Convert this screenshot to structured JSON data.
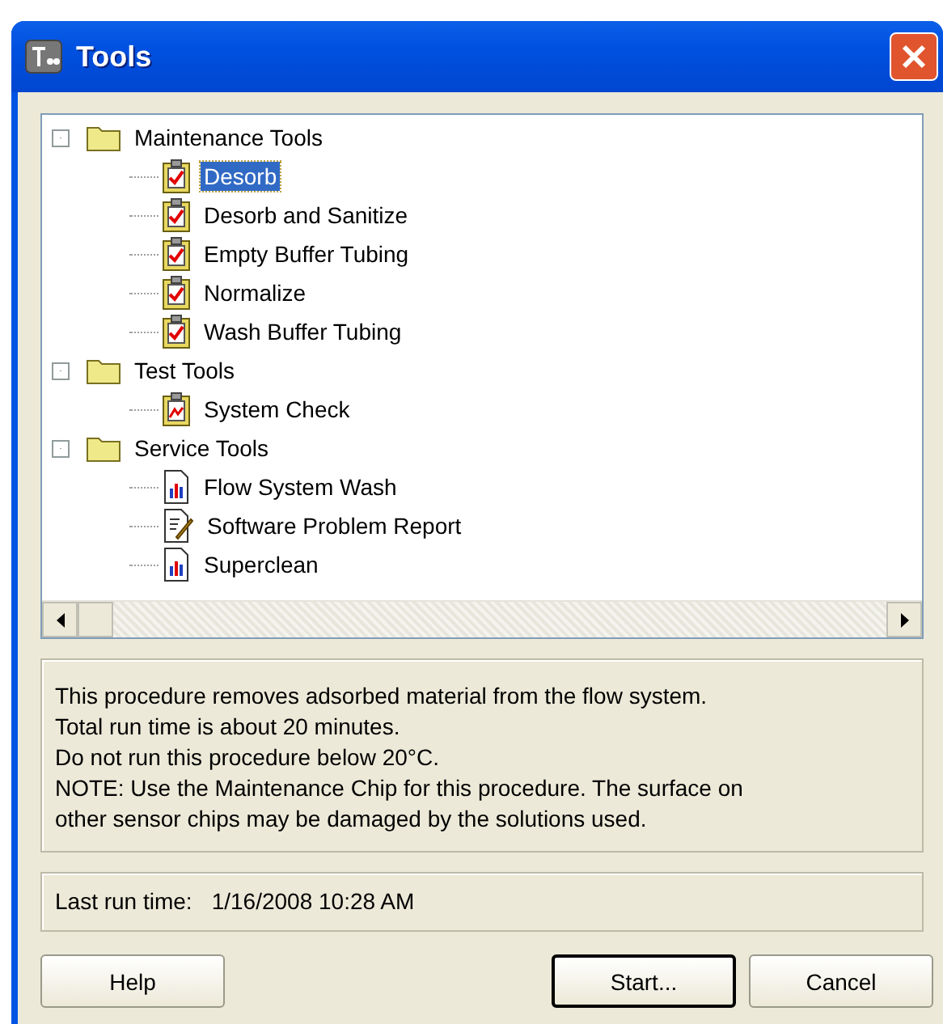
{
  "window": {
    "title": "Tools"
  },
  "tree": [
    {
      "label": "Maintenance Tools",
      "kind": "folder",
      "expanded": true,
      "selected": false,
      "children": [
        {
          "label": "Desorb",
          "kind": "checklist",
          "selected": true
        },
        {
          "label": "Desorb and Sanitize",
          "kind": "checklist",
          "selected": false
        },
        {
          "label": "Empty Buffer Tubing",
          "kind": "checklist",
          "selected": false
        },
        {
          "label": "Normalize",
          "kind": "checklist",
          "selected": false
        },
        {
          "label": "Wash Buffer Tubing",
          "kind": "checklist",
          "selected": false
        }
      ]
    },
    {
      "label": "Test Tools",
      "kind": "folder",
      "expanded": true,
      "selected": false,
      "children": [
        {
          "label": "System Check",
          "kind": "check",
          "selected": false
        }
      ]
    },
    {
      "label": "Service Tools",
      "kind": "folder",
      "expanded": true,
      "selected": false,
      "children": [
        {
          "label": "Flow System Wash",
          "kind": "chart",
          "selected": false
        },
        {
          "label": "Software Problem Report",
          "kind": "report",
          "selected": false
        },
        {
          "label": "Superclean",
          "kind": "chart",
          "selected": false
        }
      ]
    }
  ],
  "description": [
    "This procedure removes adsorbed material from the flow system.",
    "Total run time is about 20 minutes.",
    "Do not run this procedure below 20°C.",
    "NOTE: Use the Maintenance Chip for this procedure. The surface on",
    "other sensor chips may be damaged by the solutions used."
  ],
  "last_run": {
    "label": "Last run time:",
    "value": "1/16/2008 10:28 AM"
  },
  "buttons": [
    {
      "label": "Help",
      "default": false
    },
    {
      "label": "Start...",
      "default": true
    },
    {
      "label": "Cancel",
      "default": false
    }
  ]
}
